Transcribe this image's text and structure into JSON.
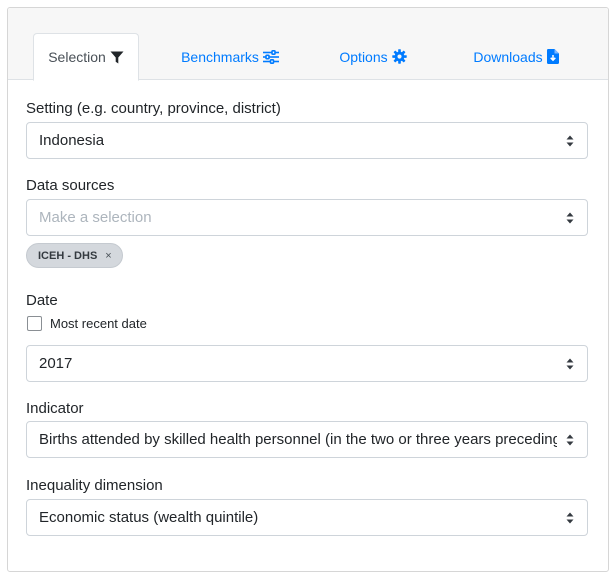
{
  "tabs": [
    {
      "label": "Selection",
      "icon": "filter-icon",
      "active": true
    },
    {
      "label": "Benchmarks",
      "icon": "sliders-icon",
      "active": false
    },
    {
      "label": "Options",
      "icon": "gear-icon",
      "active": false
    },
    {
      "label": "Downloads",
      "icon": "file-download-icon",
      "active": false
    }
  ],
  "setting": {
    "label": "Setting (e.g. country, province, district)",
    "value": "Indonesia"
  },
  "data_sources": {
    "label": "Data sources",
    "placeholder": "Make a selection",
    "chips": [
      {
        "label": "ICEH - DHS",
        "remove": "×"
      }
    ]
  },
  "date": {
    "label": "Date",
    "checkbox_label": "Most recent date",
    "checked": false,
    "value": "2017"
  },
  "indicator": {
    "label": "Indicator",
    "value": "Births attended by skilled health personnel (in the two or three years preceding the survey) (%)"
  },
  "inequality": {
    "label": "Inequality dimension",
    "value": "Economic status (wealth quintile)"
  },
  "colors": {
    "link": "#007bff",
    "active_tab_text": "#495057",
    "tabbar_bg": "#f7f7f7",
    "chip_bg": "#d4d8dd"
  }
}
